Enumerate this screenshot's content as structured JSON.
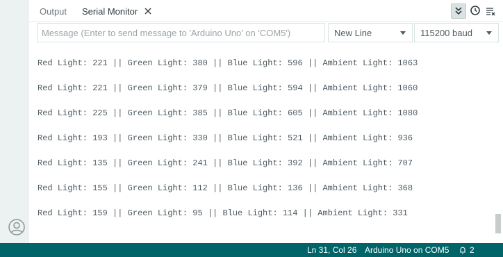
{
  "tabs": [
    {
      "label": "Output"
    },
    {
      "label": "Serial Monitor"
    }
  ],
  "toolbar": {
    "autoscroll_icon": "double-chevron-down-icon",
    "timestamp_icon": "clock-icon",
    "clear_icon": "clear-output-icon"
  },
  "message": {
    "placeholder": "Message (Enter to send message to 'Arduino Uno' on 'COM5')",
    "value": ""
  },
  "line_ending": {
    "selected": "New Line"
  },
  "baud_rate": {
    "selected": "115200 baud"
  },
  "output_lines": [
    "Red Light: 221 || Green Light: 380 || Blue Light: 596 || Ambient Light: 1063",
    "Red Light: 221 || Green Light: 379 || Blue Light: 594 || Ambient Light: 1060",
    "Red Light: 225 || Green Light: 385 || Blue Light: 605 || Ambient Light: 1080",
    "Red Light: 193 || Green Light: 330 || Blue Light: 521 || Ambient Light: 936",
    "Red Light: 135 || Green Light: 241 || Blue Light: 392 || Ambient Light: 707",
    "Red Light: 155 || Green Light: 112 || Blue Light: 136 || Ambient Light: 368",
    "Red Light: 159 || Green Light: 95 || Blue Light: 114 || Ambient Light: 331"
  ],
  "status": {
    "position": "Ln 31, Col 26",
    "board": "Arduino Uno on COM5",
    "notifications": "2"
  },
  "colors": {
    "status_bar": "#006468",
    "text": "#4e5b61",
    "rail": "#ecf1f1"
  }
}
